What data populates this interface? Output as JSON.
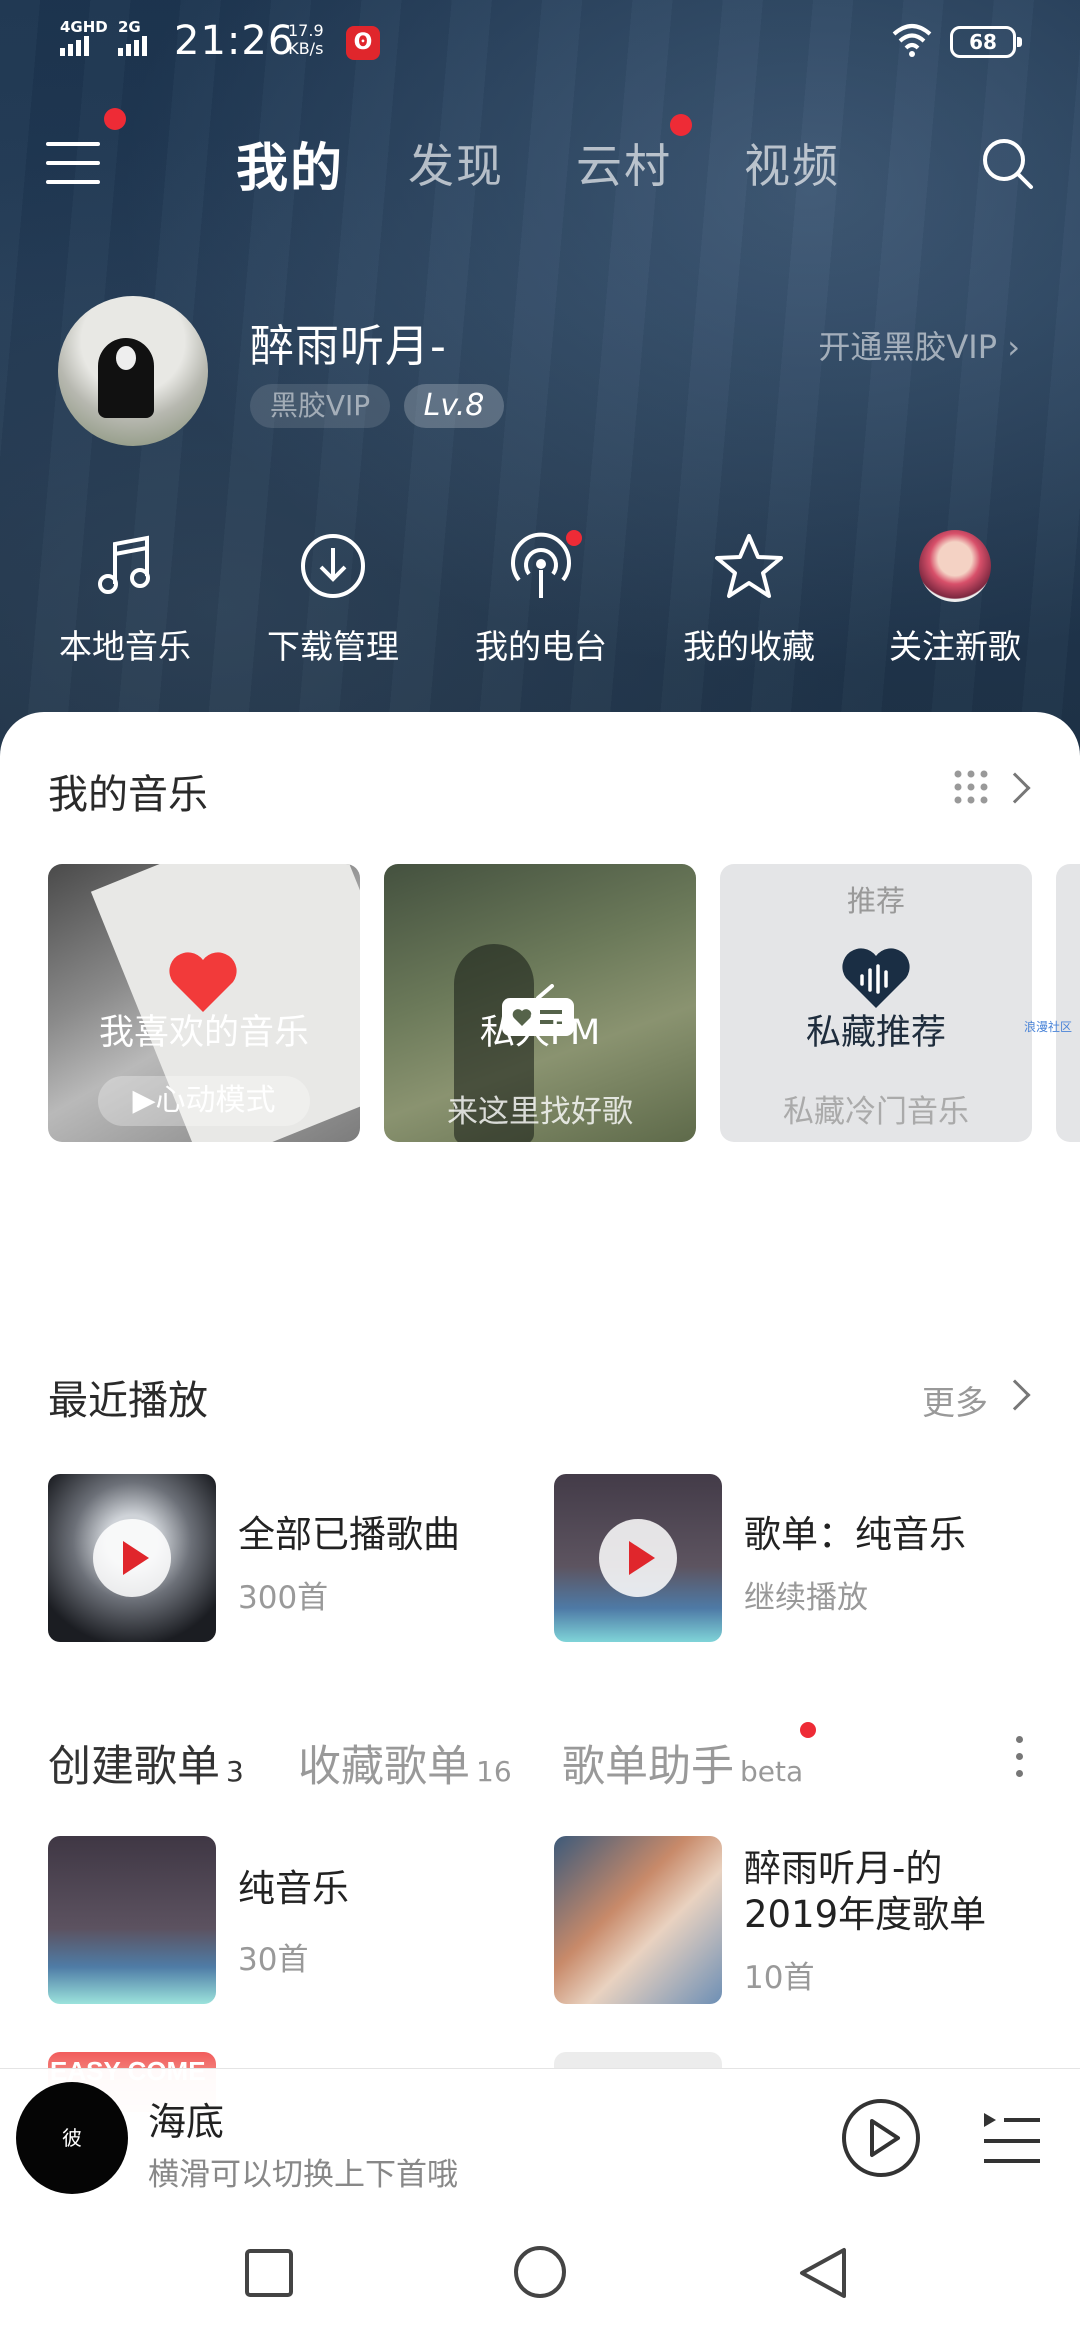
{
  "status_bar": {
    "net1": "4GHD",
    "net2": "2G",
    "time": "21:26",
    "speed_value": "17.9",
    "speed_unit": "KB/s",
    "battery": "68",
    "app_icon": "netease-music-icon"
  },
  "top_nav": {
    "tabs": [
      {
        "label": "我的",
        "active": true
      },
      {
        "label": "发现",
        "active": false
      },
      {
        "label": "云村",
        "active": false
      },
      {
        "label": "视频",
        "active": false
      }
    ],
    "menu_icon": "menu-icon",
    "search_icon": "search-icon",
    "badge_color": "#ee2b36"
  },
  "profile": {
    "username": "醉雨听月-",
    "vip_badge": "黑胶VIP",
    "level": "Lv.8",
    "vip_link": "开通黑胶VIP"
  },
  "shortcuts": [
    {
      "label": "本地音乐",
      "icon": "music-note-icon"
    },
    {
      "label": "下载管理",
      "icon": "download-icon"
    },
    {
      "label": "我的电台",
      "icon": "podcast-icon"
    },
    {
      "label": "我的收藏",
      "icon": "star-icon"
    },
    {
      "label": "关注新歌",
      "icon": "avatar-icon"
    }
  ],
  "my_music": {
    "title": "我的音乐",
    "cards": [
      {
        "title": "我喜欢的音乐",
        "button": "心动模式",
        "icon": "heart-icon"
      },
      {
        "title": "私人FM",
        "subtitle": "来这里找好歌",
        "icon": "radio-icon"
      },
      {
        "tag": "推荐",
        "title": "私藏推荐",
        "subtitle": "私藏冷门音乐",
        "icon": "heart-wave-icon"
      }
    ],
    "side_label": "浪漫社区"
  },
  "recent": {
    "title": "最近播放",
    "more": "更多",
    "items": [
      {
        "name": "全部已播歌曲",
        "sub": "300首"
      },
      {
        "name": "歌单：纯音乐",
        "sub": "继续播放"
      }
    ]
  },
  "playlists": {
    "tabs": [
      {
        "label": "创建歌单",
        "count": "3"
      },
      {
        "label": "收藏歌单",
        "count": "16"
      },
      {
        "label": "歌单助手",
        "count": "beta"
      }
    ],
    "items": [
      {
        "name": "纯音乐",
        "count": "30首"
      },
      {
        "name": "醉雨听月-的2019年度歌单",
        "count": "10首"
      }
    ],
    "peek_text": "EASY COME"
  },
  "player": {
    "song": "海底",
    "hint": "横滑可以切换上下首哦",
    "disc_text": "彼"
  },
  "nav_bar": {
    "recent_icon": "square-icon",
    "home_icon": "circle-icon",
    "back_icon": "triangle-back-icon"
  }
}
